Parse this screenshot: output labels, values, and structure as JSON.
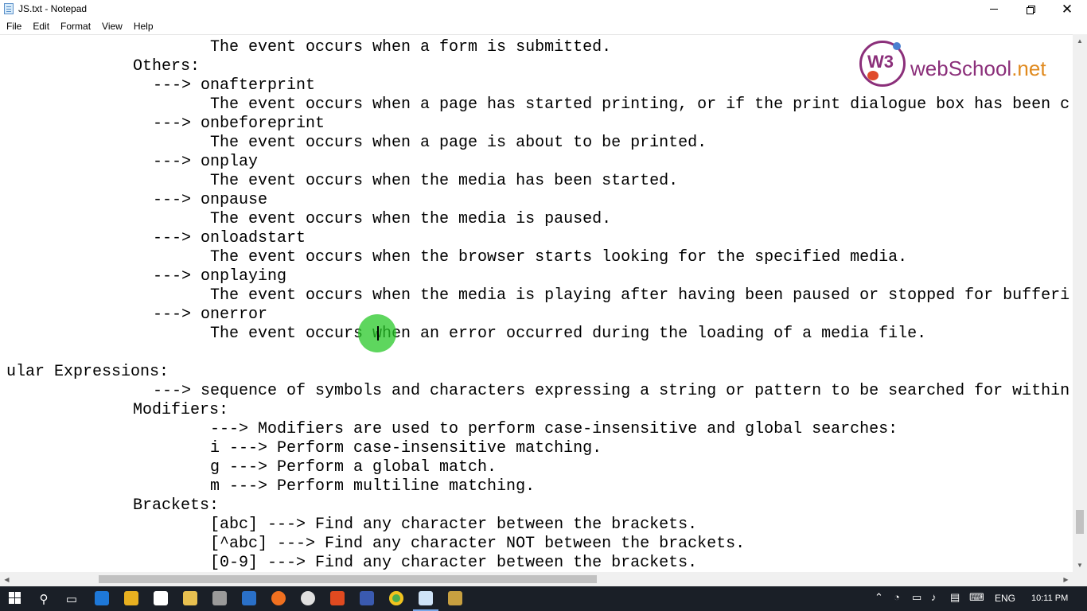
{
  "window": {
    "title": "JS.txt - Notepad"
  },
  "menu": [
    "File",
    "Edit",
    "Format",
    "View",
    "Help"
  ],
  "editor_lines": [
    "The event occurs when a form is submitted.",
    "Others:",
    "---> onafterprint",
    "The event occurs when a page has started printing, or if the print dialogue box has been c",
    "---> onbeforeprint",
    "The event occurs when a page is about to be printed.",
    "---> onplay",
    "The event occurs when the media has been started.",
    "---> onpause",
    "The event occurs when the media is paused.",
    "---> onloadstart",
    "The event occurs when the browser starts looking for the specified media.",
    "---> onplaying",
    "The event occurs when the media is playing after having been paused or stopped for bufferi",
    "---> onerror",
    "The event occurs when an error occurred during the loading of a media file.",
    "",
    "ular Expressions:",
    "---> sequence of symbols and characters expressing a string or pattern to be searched for within",
    "Modifiers:",
    "---> Modifiers are used to perform case-insensitive and global searches:",
    "i ---> Perform case-insensitive matching.",
    "g ---> Perform a global match.",
    "m ---> Perform multiline matching.",
    "Brackets:",
    "[abc] ---> Find any character between the brackets.",
    "[^abc] ---> Find any character NOT between the brackets.",
    "[0-9] ---> Find any character between the brackets."
  ],
  "watermark": {
    "badge": "W3",
    "name": "webSchool",
    "tld": ".net"
  },
  "taskbar": {
    "language": "ENG",
    "time": "10:11 PM"
  },
  "icons": {
    "app": "notepad-icon",
    "minimize": "minimize-icon",
    "maximize": "restore-icon",
    "close": "close-icon"
  },
  "colors": {
    "taskbar": "#1a1f27",
    "highlight": "#28c828",
    "brand": "#8b2f7a"
  }
}
